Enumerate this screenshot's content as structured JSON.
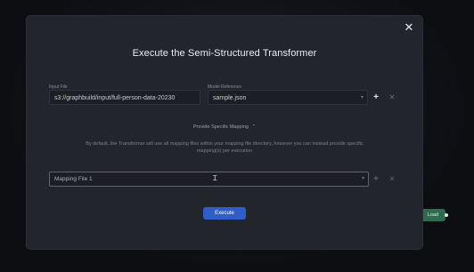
{
  "modal": {
    "title": "Execute the Semi-Structured Transformer",
    "close_icon": "close-icon",
    "input_file": {
      "label": "Input File",
      "value": "s3://graphbuild/input/full-person-data-20230"
    },
    "model_reference": {
      "label": "Model Reference",
      "value": "sample.json"
    },
    "provide_specific_mapping": "Provide Specific Mapping",
    "description": "By default, the Transformer will use all mapping files within your mapping file directory, however you can instead provide specific mapping(s) per execution",
    "mapping_select": {
      "value": "Mapping File 1"
    },
    "execute_label": "Execute"
  },
  "background": {
    "node_label": "Load"
  },
  "colors": {
    "modal_bg": "#23252c",
    "accent": "#2f5ec9",
    "focus_border": "#3e63c9",
    "node_green": "#2f6b4f"
  }
}
